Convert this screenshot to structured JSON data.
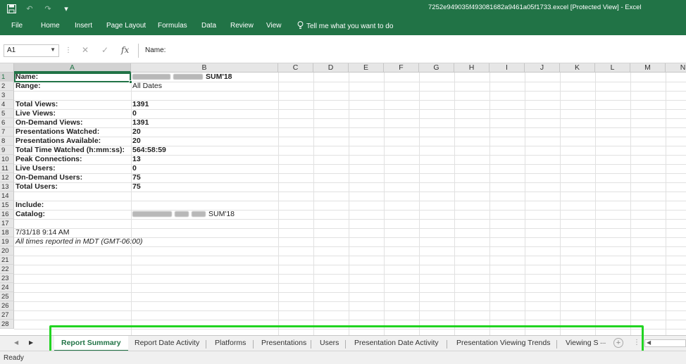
{
  "app": {
    "window_title": "7252e949035f493081682a9461a05f1733.excel  [Protected View]  -  Excel"
  },
  "ribbon": {
    "tabs": [
      "File",
      "Home",
      "Insert",
      "Page Layout",
      "Formulas",
      "Data",
      "Review",
      "View"
    ],
    "tell_me": "Tell me what you want to do"
  },
  "formula_bar": {
    "name_box": "A1",
    "content": "Name:"
  },
  "columns": [
    "A",
    "B",
    "C",
    "D",
    "E",
    "F",
    "G",
    "H",
    "I",
    "J",
    "K",
    "L",
    "M",
    "N"
  ],
  "rows": [
    "1",
    "2",
    "3",
    "4",
    "5",
    "6",
    "7",
    "8",
    "9",
    "10",
    "11",
    "12",
    "13",
    "14",
    "15",
    "16",
    "17",
    "18",
    "19",
    "20",
    "21",
    "22",
    "23",
    "24",
    "25",
    "26",
    "27",
    "28"
  ],
  "cells": {
    "r1a": "Name:",
    "r1b": "SUM'18",
    "r2a": "Range:",
    "r2b": "All Dates",
    "r4a": "Total Views:",
    "r4b": "1391",
    "r5a": "Live Views:",
    "r5b": "0",
    "r6a": "On-Demand Views:",
    "r6b": "1391",
    "r7a": "Presentations Watched:",
    "r7b": "20",
    "r8a": "Presentations Available:",
    "r8b": "20",
    "r9a": "Total Time Watched (h:mm:ss):",
    "r9b": "564:58:59",
    "r10a": "Peak Connections:",
    "r10b": "13",
    "r11a": "Live Users:",
    "r11b": "0",
    "r12a": "On-Demand Users:",
    "r12b": "75",
    "r13a": "Total Users:",
    "r13b": "75",
    "r15a": "Include:",
    "r16a": "Catalog:",
    "r16b": "SUM'18",
    "r18a": "7/31/18 9:14 AM",
    "r19a": "All times reported in MDT (GMT-06:00)"
  },
  "sheet_tabs": {
    "report_summary": "Report Summary",
    "report_date_activity": "Report Date Activity",
    "platforms": "Platforms",
    "presentations": "Presentations",
    "users": "Users",
    "presentation_date_activity": "Presentation Date Activity",
    "presentation_viewing_trends": "Presentation Viewing Trends",
    "viewing_s": "Viewing S",
    "more": "..."
  },
  "status": {
    "text": "Ready"
  },
  "colors": {
    "accent": "#217346",
    "highlight": "#22d422"
  }
}
